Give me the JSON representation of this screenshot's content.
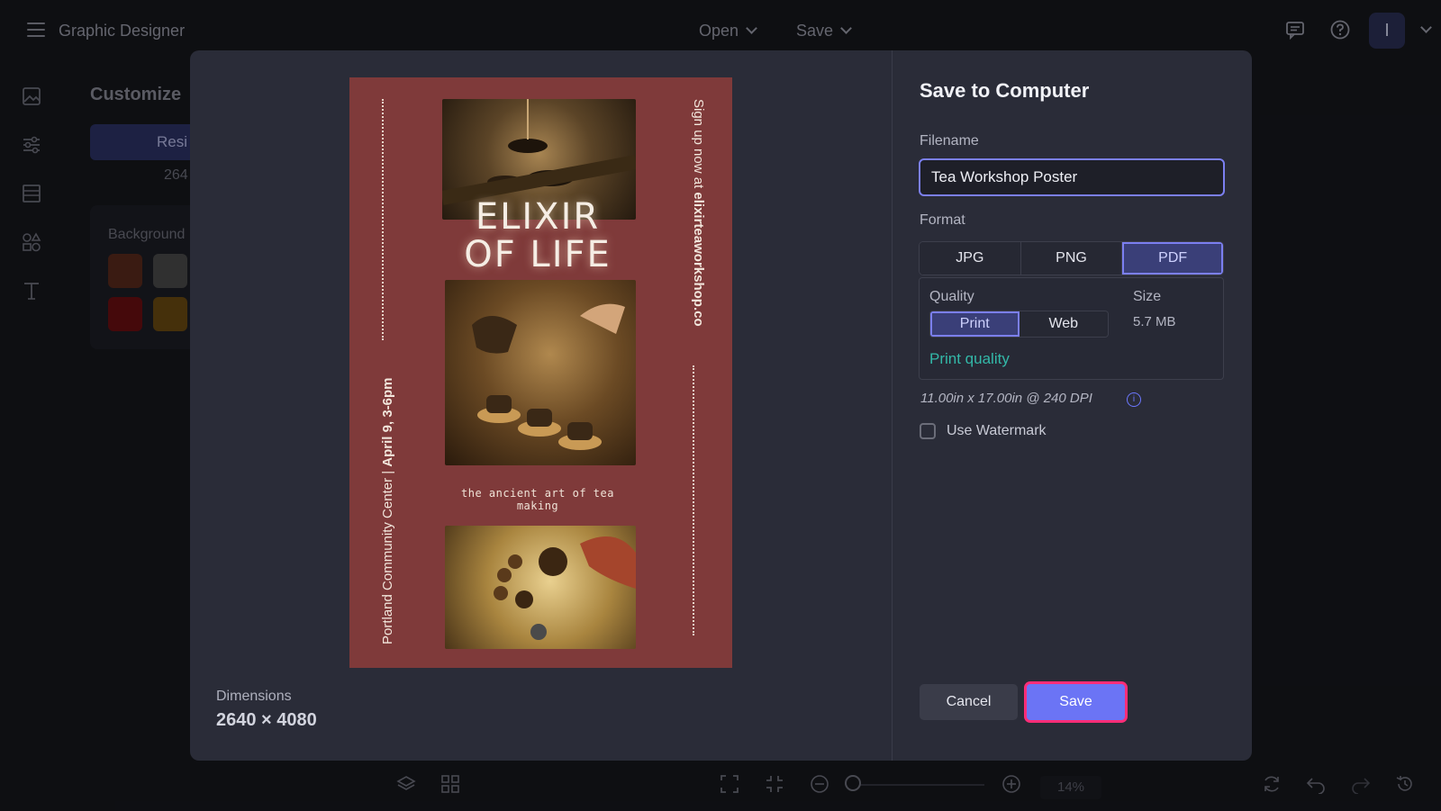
{
  "app": {
    "title": "Graphic Designer",
    "open_label": "Open",
    "save_label": "Save",
    "avatar_initial": "I",
    "zoom": "14%"
  },
  "customize": {
    "title": "Customize",
    "resize_label": "Resi",
    "size_fragment": "264",
    "background_label": "Background",
    "swatches": [
      "#5a2a1d",
      "#4a4a4a",
      "#6a0f12",
      "#6b4a12"
    ]
  },
  "poster": {
    "title_line1": "ELIXIR",
    "title_line2": "OF LIFE",
    "tagline": "the ancient art of tea making",
    "left_text_regular": "Portland Community Center | ",
    "left_text_bold": "April 9, 3-6pm",
    "right_text_regular": "Sign up now at ",
    "right_text_bold": "elixirteaworkshop.co",
    "background_color": "#7f3a3a"
  },
  "dimensions": {
    "label": "Dimensions",
    "value": "2640 × 4080"
  },
  "dialog": {
    "title": "Save to Computer",
    "filename_label": "Filename",
    "filename_value": "Tea Workshop Poster",
    "format_label": "Format",
    "formats": [
      "JPG",
      "PNG",
      "PDF"
    ],
    "selected_format": "PDF",
    "quality_label": "Quality",
    "qualities": [
      "Print",
      "Web"
    ],
    "selected_quality": "Print",
    "quality_description": "Print quality",
    "size_label": "Size",
    "size_value": "5.7 MB",
    "dpi_text": "11.00in x 17.00in @ 240 DPI",
    "watermark_label": "Use Watermark",
    "watermark_checked": false,
    "cancel_label": "Cancel",
    "save_label": "Save"
  },
  "colors": {
    "accent": "#6b74f5",
    "highlight": "#ff2d78",
    "teal": "#33b8a8"
  }
}
